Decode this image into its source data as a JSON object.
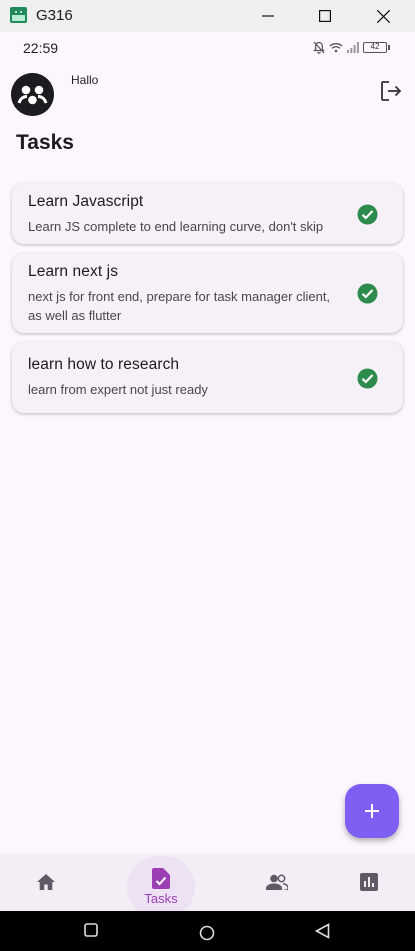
{
  "window": {
    "title": "G316"
  },
  "status_bar": {
    "time": "22:59",
    "battery": "42"
  },
  "header": {
    "greeting": "Hallo"
  },
  "page": {
    "title": "Tasks"
  },
  "tasks": [
    {
      "title": "Learn Javascript",
      "description": "Learn JS complete to end learning curve, don't skip",
      "done": true
    },
    {
      "title": "Learn next js",
      "description": "next js for front end, prepare for task manager client, as well as flutter",
      "done": true
    },
    {
      "title": "learn how to research",
      "description": "learn from expert not just ready",
      "done": true
    }
  ],
  "nav": {
    "tasks_label": "Tasks"
  },
  "colors": {
    "accent": "#7e5ef3",
    "check": "#2e8b4e",
    "nav_active": "#9c3fb5"
  }
}
